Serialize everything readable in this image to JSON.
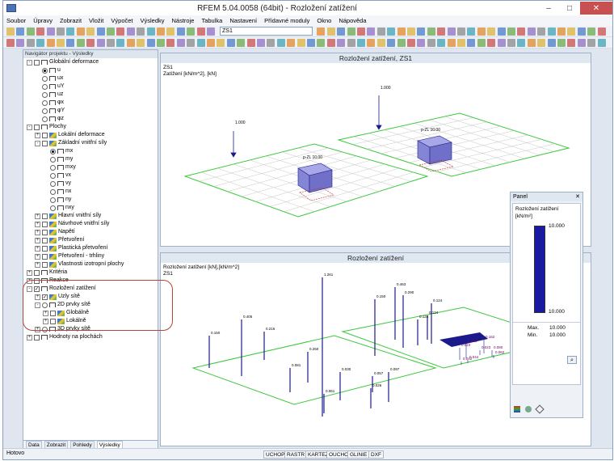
{
  "titlebar": {
    "title": "RFEM 5.04.0058 (64bit) - Rozložení zatížení",
    "minimize": "–",
    "maximize": "□",
    "close": "✕"
  },
  "menu": [
    "Soubor",
    "Úpravy",
    "Zobrazit",
    "Vložit",
    "Výpočet",
    "Výsledky",
    "Nástroje",
    "Tabulka",
    "Nastavení",
    "Přídavné moduly",
    "Okno",
    "Nápověda"
  ],
  "toolbar": {
    "combo_value": "ZS1"
  },
  "navigator": {
    "header": "Navigátor projektu - Výsledky",
    "tree": [
      {
        "label": "Globální deformace",
        "depth": 0,
        "kind": "checkbox",
        "exp": "-"
      },
      {
        "label": "u",
        "depth": 1,
        "kind": "radio",
        "on": true
      },
      {
        "label": "ux",
        "depth": 1,
        "kind": "radio"
      },
      {
        "label": "uY",
        "depth": 1,
        "kind": "radio"
      },
      {
        "label": "uz",
        "depth": 1,
        "kind": "radio"
      },
      {
        "label": "φx",
        "depth": 1,
        "kind": "radio"
      },
      {
        "label": "φY",
        "depth": 1,
        "kind": "radio"
      },
      {
        "label": "φz",
        "depth": 1,
        "kind": "radio"
      },
      {
        "label": "Plochy",
        "depth": 0,
        "kind": "checkbox",
        "exp": "-"
      },
      {
        "label": "Lokální deformace",
        "depth": 1,
        "kind": "box",
        "exp": "+"
      },
      {
        "label": "Základní vnitřní síly",
        "depth": 1,
        "kind": "box",
        "exp": "-"
      },
      {
        "label": "mx",
        "depth": 2,
        "kind": "radio",
        "on": true
      },
      {
        "label": "my",
        "depth": 2,
        "kind": "radio"
      },
      {
        "label": "mxy",
        "depth": 2,
        "kind": "radio"
      },
      {
        "label": "vx",
        "depth": 2,
        "kind": "radio"
      },
      {
        "label": "vy",
        "depth": 2,
        "kind": "radio"
      },
      {
        "label": "nx",
        "depth": 2,
        "kind": "radio"
      },
      {
        "label": "ny",
        "depth": 2,
        "kind": "radio"
      },
      {
        "label": "nxy",
        "depth": 2,
        "kind": "radio"
      },
      {
        "label": "Hlavní vnitřní síly",
        "depth": 1,
        "kind": "box",
        "exp": "+"
      },
      {
        "label": "Návrhové vnitřní síly",
        "depth": 1,
        "kind": "box",
        "exp": "+"
      },
      {
        "label": "Napětí",
        "depth": 1,
        "kind": "box",
        "exp": "+"
      },
      {
        "label": "Přetvoření",
        "depth": 1,
        "kind": "box",
        "exp": "+"
      },
      {
        "label": "Plastická přetvoření",
        "depth": 1,
        "kind": "box",
        "exp": "+"
      },
      {
        "label": "Přetvoření - trhliny",
        "depth": 1,
        "kind": "box",
        "exp": "+"
      },
      {
        "label": "Vlastnosti izotropní plochy",
        "depth": 1,
        "kind": "box",
        "exp": "+"
      },
      {
        "label": "Kritéria",
        "depth": 0,
        "kind": "checkbox",
        "exp": "+"
      },
      {
        "label": "Reakce",
        "depth": 0,
        "kind": "checkbox",
        "exp": "+"
      },
      {
        "label": "Rozložení zatížení",
        "depth": 0,
        "kind": "checkbox",
        "checked": true,
        "exp": "-"
      },
      {
        "label": "Uzly sítě",
        "depth": 1,
        "kind": "checkbox",
        "checked": true,
        "exp": "+"
      },
      {
        "label": "2D prvky sítě",
        "depth": 1,
        "kind": "radio",
        "exp": "-"
      },
      {
        "label": "Globálně",
        "depth": 2,
        "kind": "box",
        "exp": "+"
      },
      {
        "label": "Lokálně",
        "depth": 2,
        "kind": "box",
        "exp": "+"
      },
      {
        "label": "3D prvky sítě",
        "depth": 1,
        "kind": "radio",
        "exp": "+"
      },
      {
        "label": "Hodnoty na plochách",
        "depth": 0,
        "kind": "checkbox",
        "exp": "+"
      }
    ],
    "tabs": [
      "Data",
      "Zobrazit",
      "Pohledy",
      "Výsledky"
    ]
  },
  "win_top": {
    "title": "Rozložení zatížení, ZS1",
    "line1": "ZS1",
    "line2": "Zatížení [kN/m^2], [kN]",
    "labels": [
      "1.000",
      "1.000",
      "p-ZL 10.00",
      "p-ZL 10.00"
    ]
  },
  "win_bottom": {
    "title": "Rozložení zatížení",
    "line1": "Rozložení zatížení [kN],[kN/m^2]",
    "line2": "ZS1",
    "labels": [
      "1.261",
      "0.463",
      "0.405",
      "0.290",
      "0.150",
      "0.150",
      "0.216",
      "0.124",
      "0.124",
      "0.250",
      "0.124",
      "0.081",
      "0.030",
      "0.057",
      "0.097",
      "0.026",
      "0.061",
      "0.023",
      "0.063",
      "0.162",
      "0.023",
      "0.080",
      "0.044",
      "0.042",
      "0.062"
    ]
  },
  "panel": {
    "title": "Panel",
    "close": "✕",
    "subtitle": "Rozložení zatížení",
    "unit": "[kN/m²]",
    "top": "10.000",
    "bottom": "10.000",
    "max_label": "Max.",
    "max_value": "10.000",
    "min_label": "Min.",
    "min_value": "10.000",
    "bar_color": "#1a1aa0"
  },
  "statusbar": {
    "left": "Hotovo",
    "buttons": [
      "UCHOP",
      "RASTR",
      "KARTEZ",
      "OUCHOP",
      "GLINIE",
      "DXF"
    ]
  }
}
